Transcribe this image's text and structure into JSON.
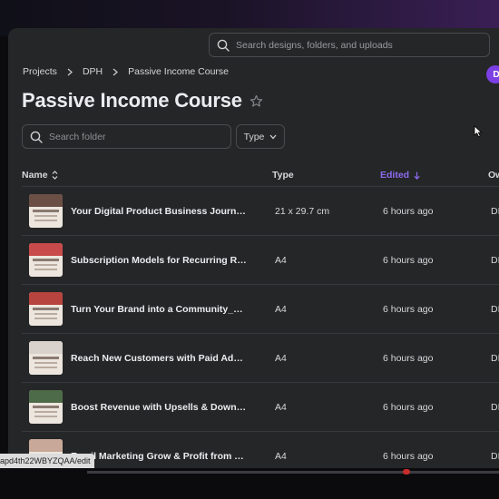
{
  "search": {
    "placeholder": "Search designs, folders, and uploads"
  },
  "breadcrumb": [
    "Projects",
    "DPH",
    "Passive Income Course"
  ],
  "avatar": {
    "initial": "D",
    "color": "#7b3fe4"
  },
  "page_title": "Passive Income Course",
  "folder_search": {
    "placeholder": "Search folder"
  },
  "type_filter": {
    "label": "Type"
  },
  "table": {
    "headers": {
      "name": "Name",
      "type": "Type",
      "edited": "Edited",
      "owner": "Ow"
    },
    "sort_column": "Edited",
    "accent": "#8d6bf0",
    "rows": [
      {
        "name": "Your Digital Product Business Journey_DPH",
        "type": "21 x 29.7 cm",
        "edited": "6 hours ago",
        "owner": "DI",
        "thumb_color": "#6b4f45"
      },
      {
        "name": "Subscription Models for Recurring Revenue_DPH",
        "type": "A4",
        "edited": "6 hours ago",
        "owner": "DI",
        "thumb_color": "#c94a4a"
      },
      {
        "name": "Turn Your Brand into a Community_DPH",
        "type": "A4",
        "edited": "6 hours ago",
        "owner": "DI",
        "thumb_color": "#b8443f"
      },
      {
        "name": "Reach New Customers with Paid Ads (Beginner)_DPH",
        "type": "A4",
        "edited": "6 hours ago",
        "owner": "DI",
        "thumb_color": "#d9d2cc"
      },
      {
        "name": "Boost Revenue with Upsells & Downsells_DPH",
        "type": "A4",
        "edited": "6 hours ago",
        "owner": "DI",
        "thumb_color": "#4d6b48"
      },
      {
        "name": "Email Marketing Grow & Profit from Your List_DPH",
        "type": "A4",
        "edited": "6 hours ago",
        "owner": "DI",
        "thumb_color": "#c8a898"
      }
    ]
  },
  "status_url": "apd4th22WBYZQAA/edit"
}
